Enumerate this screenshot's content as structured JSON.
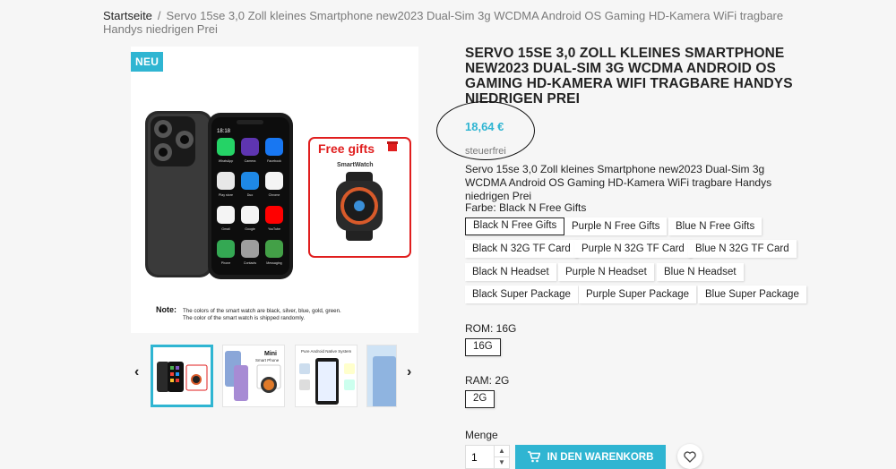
{
  "breadcrumb": {
    "home": "Startseite",
    "separator": "/",
    "current": "Servo 15se 3,0 Zoll kleines Smartphone new2023 Dual-Sim 3g WCDMA Android OS Gaming HD-Kamera WiFi tragbare Handys niedrigen Prei"
  },
  "gallery": {
    "badge": "NEU",
    "free_gifts": "Free gifts",
    "smartwatch": "SmartWatch",
    "phone_time": "18:18",
    "app_labels": [
      "WhatsApp",
      "Camera",
      "Facebook",
      "Play store",
      "Duo",
      "Chrome",
      "Gmail",
      "Google",
      "YouTube",
      "Phone",
      "Contacts",
      "Messaging"
    ],
    "note_label": "Note:",
    "note_line1": "The colors of the smart watch are black, silver, blue, gold, green.",
    "note_line2": "The color of the smart watch is shipped randomly.",
    "thumb2_text1": "Mini",
    "thumb2_text2": "Smart Phone",
    "thumb3_text": "Pure Android Native System",
    "prev_arrow": "‹",
    "next_arrow": "›"
  },
  "product": {
    "title": "Servo 15se 3,0 Zoll kleines Smartphone new2023 Dual-Sim 3g WCDMA Android OS Gaming HD-Kamera WiFi tragbare Handys niedrigen Prei",
    "price": "18,64 €",
    "tax": "steuerfrei",
    "description": "Servo 15se 3,0 Zoll kleines Smartphone new2023 Dual-Sim 3g WCDMA Android OS Gaming HD-Kamera WiFi tragbare Handys niedrigen Prei"
  },
  "variants": {
    "color_label": "Farbe: Black N Free Gifts",
    "colors": [
      "Black N Free Gifts",
      "Purple N Free Gifts",
      "Blue N Free Gifts",
      "Black N 32G TF Card",
      "Purple N 32G TF Card",
      "Blue N 32G TF Card",
      "Black N Headset",
      "Purple N Headset",
      "Blue N Headset",
      "Black Super Package",
      "Purple Super Package",
      "Blue Super Package"
    ],
    "rom_label": "ROM: 16G",
    "rom_options": [
      "16G"
    ],
    "ram_label": "RAM: 2G",
    "ram_options": [
      "2G"
    ]
  },
  "purchase": {
    "qty_label": "Menge",
    "qty_value": "1",
    "add_to_cart": "IN DEN WARENKORB"
  },
  "colors": {
    "accent": "#2fb5d2",
    "text": "#232323",
    "muted": "#7a7a7a",
    "background": "#f6f6f6"
  },
  "icons": {
    "cart": "shopping-cart-icon",
    "wishlist": "heart-icon",
    "gift": "gift-icon"
  }
}
